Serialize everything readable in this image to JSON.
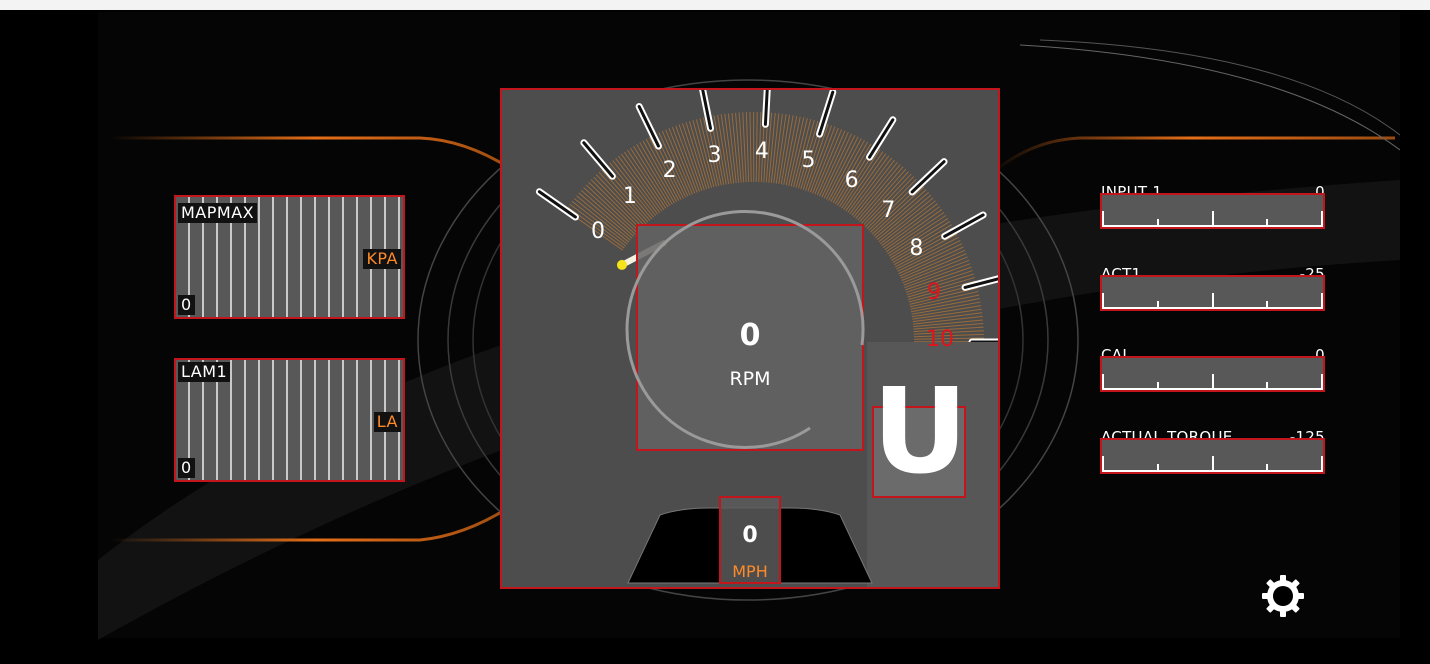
{
  "left_gauges": [
    {
      "label": "MAPMAX",
      "unit": "KPA",
      "value": "0"
    },
    {
      "label": "LAM1",
      "unit": "LA",
      "value": "0"
    }
  ],
  "tach": {
    "ticks": [
      "0",
      "1",
      "2",
      "3",
      "4",
      "5",
      "6",
      "7",
      "8",
      "9",
      "10"
    ],
    "redline_ticks": [
      "9",
      "10"
    ],
    "rpm_value": "0",
    "rpm_label": "RPM"
  },
  "speed": {
    "value": "0",
    "unit": "MPH"
  },
  "gear": {
    "value": "U"
  },
  "right_bars": [
    {
      "label": "INPUT 1",
      "value": "0"
    },
    {
      "label": "ACT1",
      "value": "-25"
    },
    {
      "label": "CAL",
      "value": "0"
    },
    {
      "label": "ACTUAL TORQUE",
      "value": "-125"
    }
  ],
  "settings_icon": "gear-icon",
  "colors": {
    "accent_red": "#c3161c",
    "accent_orange": "#ff8a2a",
    "panel_gray": "#585858"
  }
}
